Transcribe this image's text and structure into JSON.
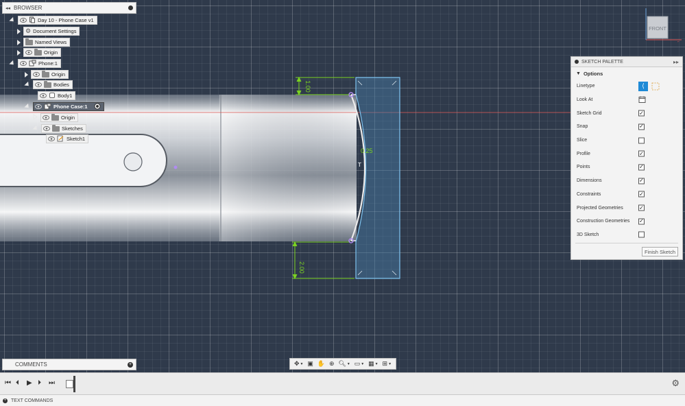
{
  "browser": {
    "title": "BROWSER",
    "tree": [
      {
        "label": "Day 10 - Phone Case v1",
        "kind": "doc"
      },
      {
        "label": "Document Settings",
        "kind": "gear"
      },
      {
        "label": "Named Views",
        "kind": "folder"
      },
      {
        "label": "Origin",
        "kind": "folder"
      },
      {
        "label": "Phone:1",
        "kind": "component"
      },
      {
        "label": "Origin",
        "kind": "folder"
      },
      {
        "label": "Bodies",
        "kind": "folder"
      },
      {
        "label": "Body1",
        "kind": "body"
      },
      {
        "label": "Phone Case:1",
        "kind": "component-active"
      },
      {
        "label": "Origin",
        "kind": "folder"
      },
      {
        "label": "Sketches",
        "kind": "folder"
      },
      {
        "label": "Sketch1",
        "kind": "sketch"
      }
    ]
  },
  "comments": {
    "title": "COMMENTS"
  },
  "palette": {
    "title": "SKETCH PALETTE",
    "section": "Options",
    "rows": [
      {
        "label": "Linetype",
        "type": "linetype"
      },
      {
        "label": "Look At",
        "type": "lookat"
      },
      {
        "label": "Sketch Grid",
        "checked": true
      },
      {
        "label": "Snap",
        "checked": true
      },
      {
        "label": "Slice",
        "checked": false
      },
      {
        "label": "Profile",
        "checked": true
      },
      {
        "label": "Points",
        "checked": true
      },
      {
        "label": "Dimensions",
        "checked": true
      },
      {
        "label": "Constraints",
        "checked": true
      },
      {
        "label": "Projected Geometries",
        "checked": true
      },
      {
        "label": "Construction Geometries",
        "checked": true
      },
      {
        "label": "3D Sketch",
        "checked": false
      }
    ],
    "finish_label": "Finish Sketch"
  },
  "viewcube": {
    "face_label": "FRONT"
  },
  "dimensions": {
    "top": "1.00",
    "bottom": "2.00",
    "radius": "0.25"
  },
  "textcommands": {
    "label": "TEXT COMMANDS"
  },
  "colors": {
    "viewport_bg": "#2f3a4b",
    "dimension": "#7bd321",
    "sketch_line": "#e6e6e6",
    "profile_fill": "#4a7fa8",
    "profile_stroke": "#7ec3f0",
    "point": "#b08cf0",
    "axis_red": "#d9534f",
    "accent": "#1e8ad6"
  }
}
